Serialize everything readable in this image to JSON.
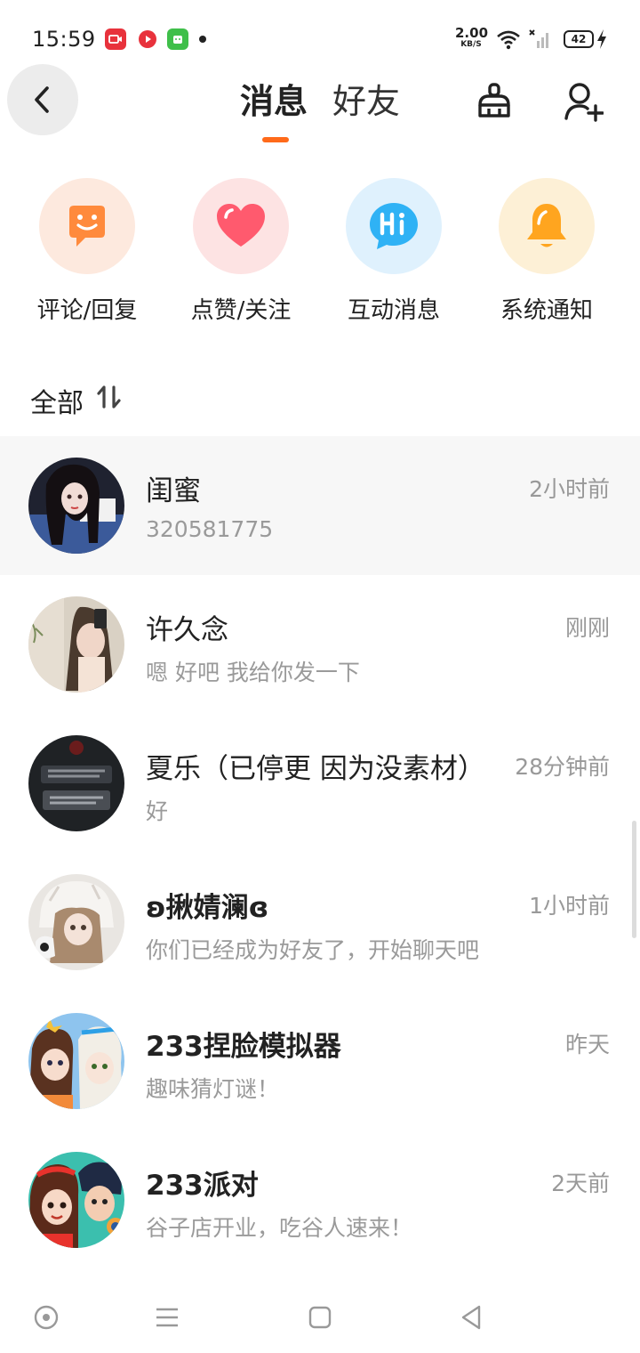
{
  "status_bar": {
    "time": "15:59",
    "net_speed_value": "2.00",
    "net_speed_unit": "KB/S",
    "battery": "42",
    "icons": [
      "video-app-icon",
      "player-app-icon",
      "android-app-icon",
      "wifi-icon",
      "signal-icon",
      "battery-icon",
      "charging-icon"
    ]
  },
  "header": {
    "tabs": [
      {
        "label": "消息",
        "active": true
      },
      {
        "label": "好友",
        "active": false
      }
    ],
    "accent": "#ff6a1a"
  },
  "shortcuts": [
    {
      "label": "评论/回复",
      "icon": "smile-chat-icon",
      "bg": "#fde9de",
      "color": "#ff8a3c"
    },
    {
      "label": "点赞/关注",
      "icon": "heart-icon",
      "bg": "#fde3e3",
      "color": "#ff5a6e"
    },
    {
      "label": "互动消息",
      "icon": "hi-bubble-icon",
      "bg": "#dff1fd",
      "color": "#2fb2f5"
    },
    {
      "label": "系统通知",
      "icon": "bell-icon",
      "bg": "#fdf0d6",
      "color": "#ffa51f"
    }
  ],
  "list_header": {
    "title": "全部",
    "sort_icon": "sort-icon"
  },
  "conversations": [
    {
      "name": "闺蜜",
      "time": "2小时前",
      "message": "320581775",
      "highlighted": true,
      "bold": false
    },
    {
      "name": "许久念",
      "time": "刚刚",
      "message": "嗯 好吧 我给你发一下",
      "highlighted": false,
      "bold": false
    },
    {
      "name": "夏乐（已停更 因为没素材）",
      "time": "28分钟前",
      "message": "好",
      "highlighted": false,
      "bold": false
    },
    {
      "name": "ʚ揪婧澜ɞ",
      "time": "1小时前",
      "message": "你们已经成为好友了，开始聊天吧",
      "highlighted": false,
      "bold": true
    },
    {
      "name": "233捏脸模拟器",
      "time": "昨天",
      "message": "趣味猜灯谜！",
      "highlighted": false,
      "bold": true
    },
    {
      "name": "233派对",
      "time": "2天前",
      "message": "谷子店开业，吃谷人速来！",
      "highlighted": false,
      "bold": true
    }
  ],
  "navbar": {
    "icons": [
      "home-circle-icon",
      "menu-icon",
      "square-icon",
      "back-triangle-icon"
    ]
  }
}
